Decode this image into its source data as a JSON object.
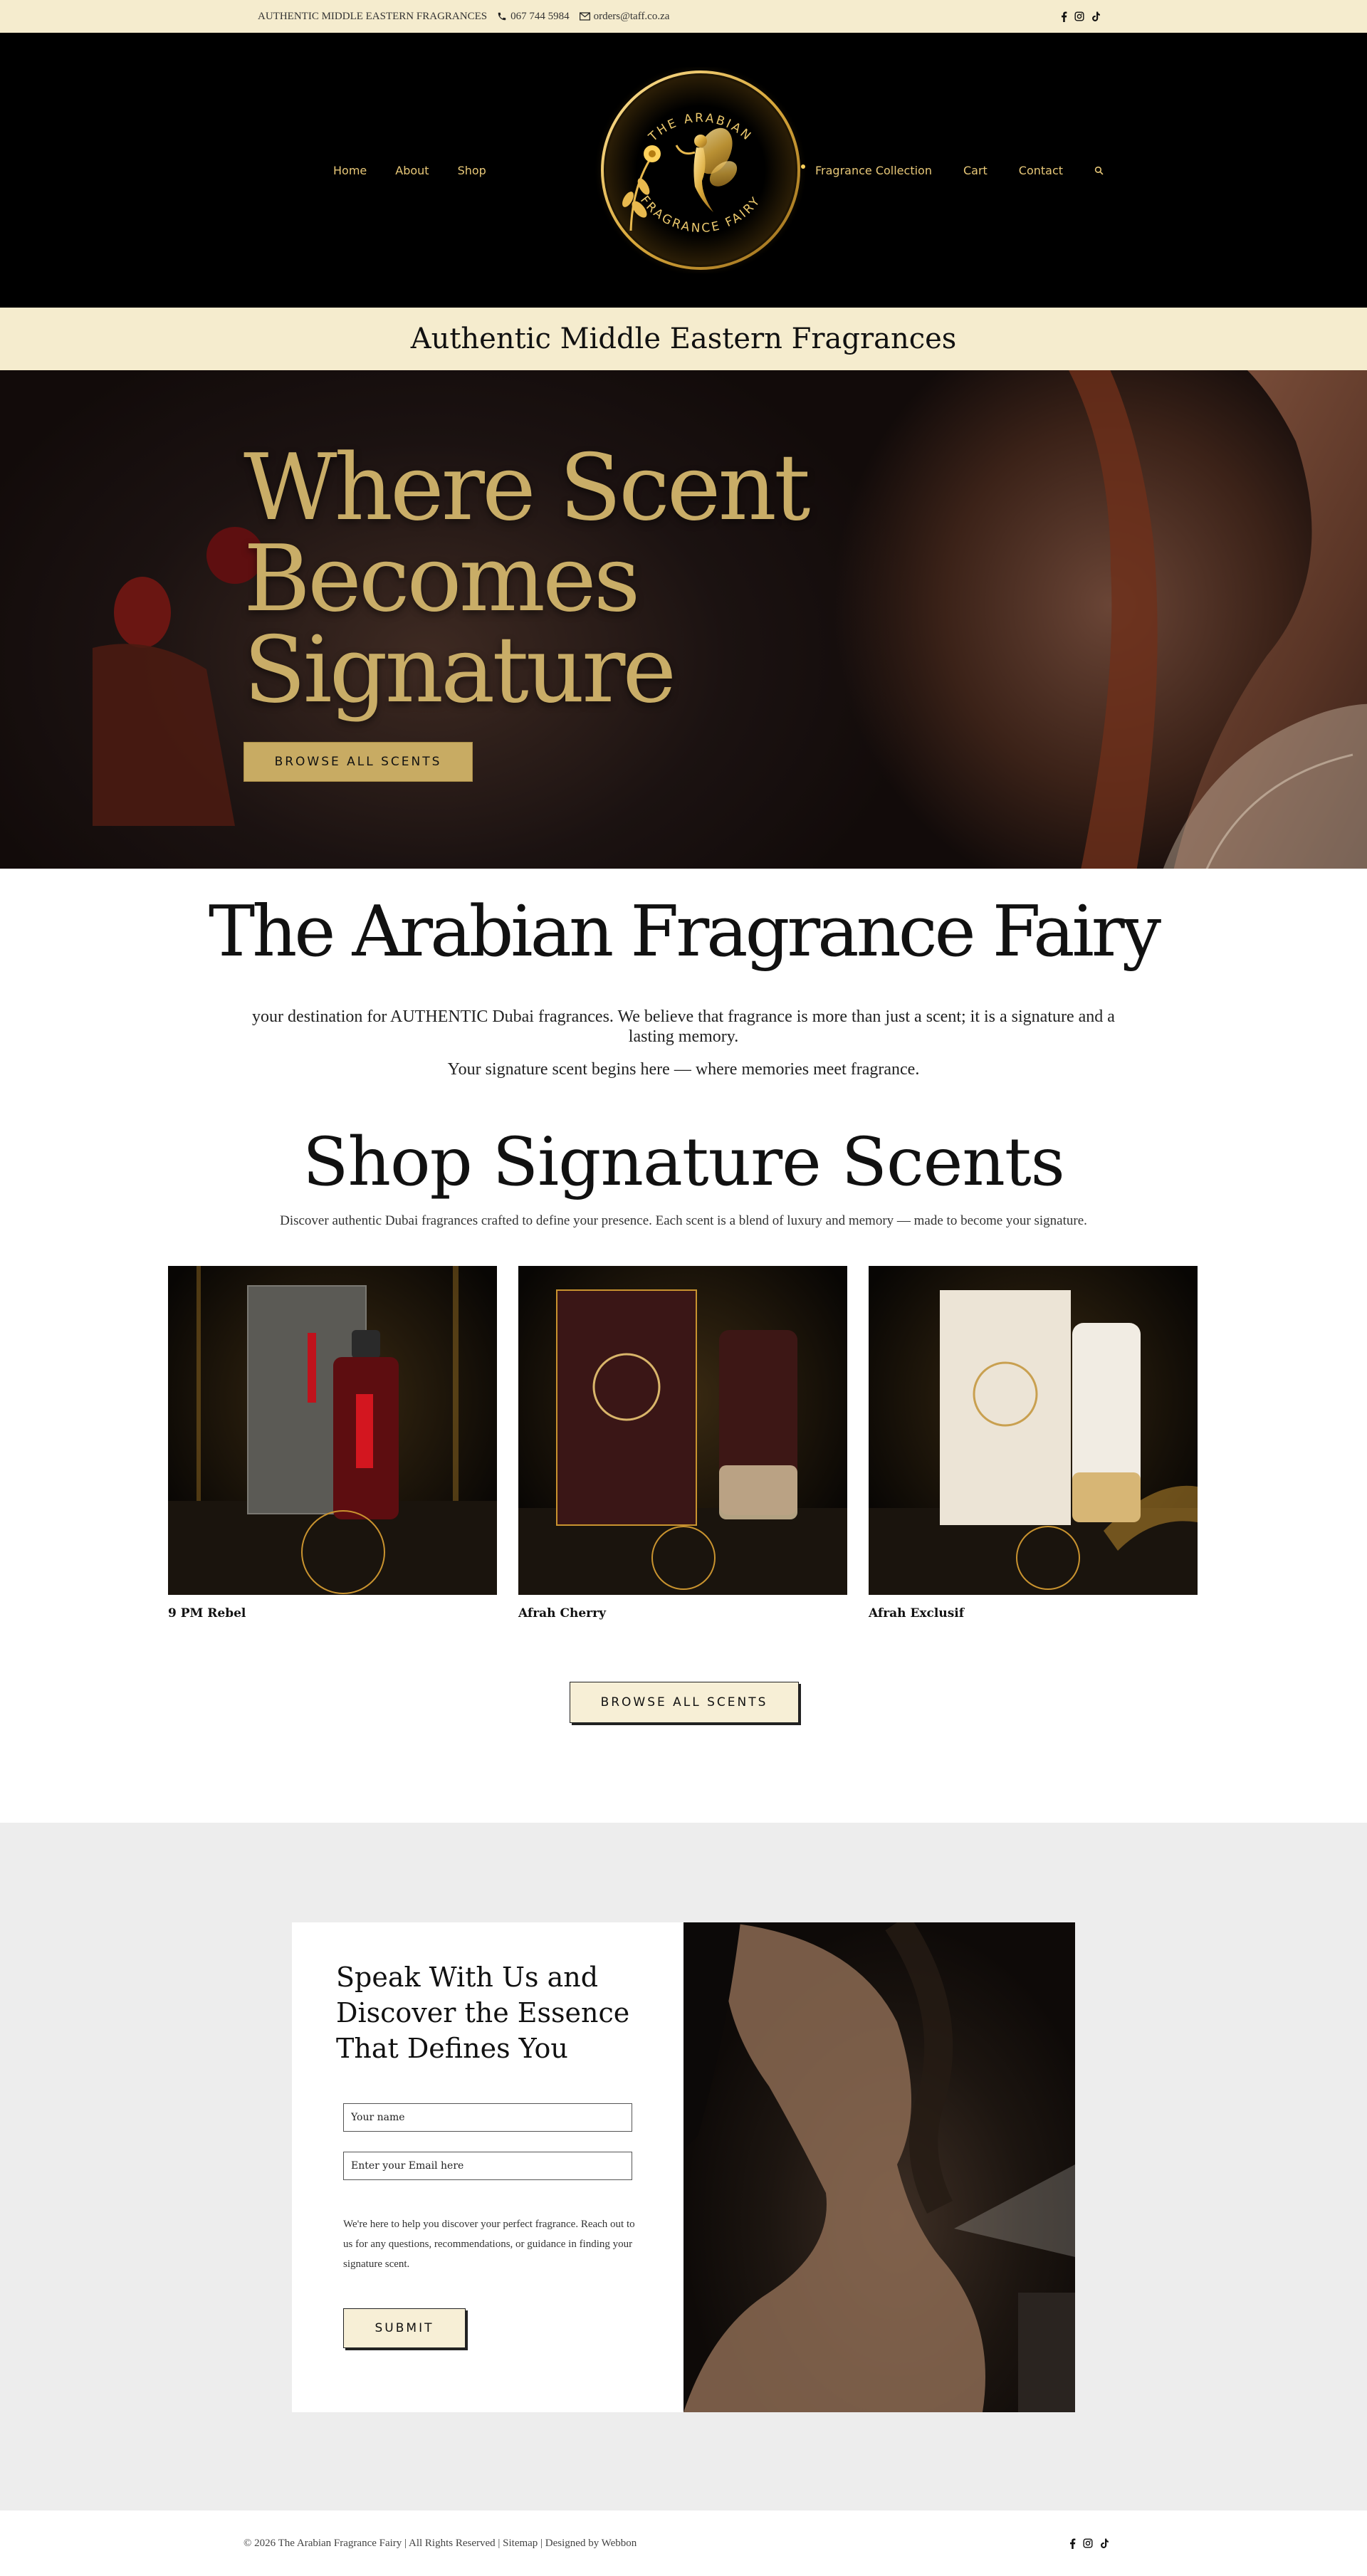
{
  "topbar": {
    "tagline": "AUTHENTIC MIDDLE EASTERN FRAGRANCES",
    "phone": "067 744 5984",
    "email": "orders@taff.co.za",
    "social_icons": [
      "facebook-icon",
      "instagram-icon",
      "tiktok-icon"
    ]
  },
  "header": {
    "nav_left": [
      "Home",
      "About",
      "Shop"
    ],
    "nav_right": [
      "Fragrance Collection",
      "Cart",
      "Contact"
    ],
    "logo_top": "THE ARABIAN",
    "logo_bottom": "FRAGRANCE FAIRY",
    "search_icon": "search-icon"
  },
  "tagband": {
    "text": "Authentic Middle Eastern Fragrances"
  },
  "hero": {
    "headline": "Where Scent Becomes Signature",
    "button": "BROWSE ALL SCENTS"
  },
  "intro": {
    "title": "The Arabian Fragrance Fairy",
    "paragraph1": "your destination for AUTHENTIC Dubai fragrances. We believe that fragrance is more than just a scent; it is a signature and a lasting memory.",
    "paragraph2": "Your signature scent begins here — where memories meet fragrance."
  },
  "shop": {
    "title": "Shop Signature Scents",
    "subtitle": "Discover authentic Dubai fragrances crafted to define your presence. Each scent is a blend of luxury and memory — made to become your signature.",
    "products": [
      {
        "name": "9 PM Rebel"
      },
      {
        "name": "Afrah Cherry"
      },
      {
        "name": "Afrah Exclusif"
      }
    ],
    "button": "BROWSE ALL SCENTS"
  },
  "contact": {
    "heading": "Speak With Us and Discover the Essence That Defines You",
    "name_placeholder": "Your name",
    "email_placeholder": "Enter your Email here",
    "text": "We're here to help you discover your perfect fragrance. Reach out to us for any questions, recommendations, or guidance in finding your signature scent.",
    "submit": "SUBMIT"
  },
  "footer": {
    "copyright": "© 2026 The Arabian Fragrance Fairy | All Rights Reserved | Sitemap | Designed by Webbon"
  },
  "colors": {
    "cream": "#f5ecce",
    "gold": "#c8ab63",
    "nav_gold": "#e8c878",
    "black": "#000000"
  }
}
